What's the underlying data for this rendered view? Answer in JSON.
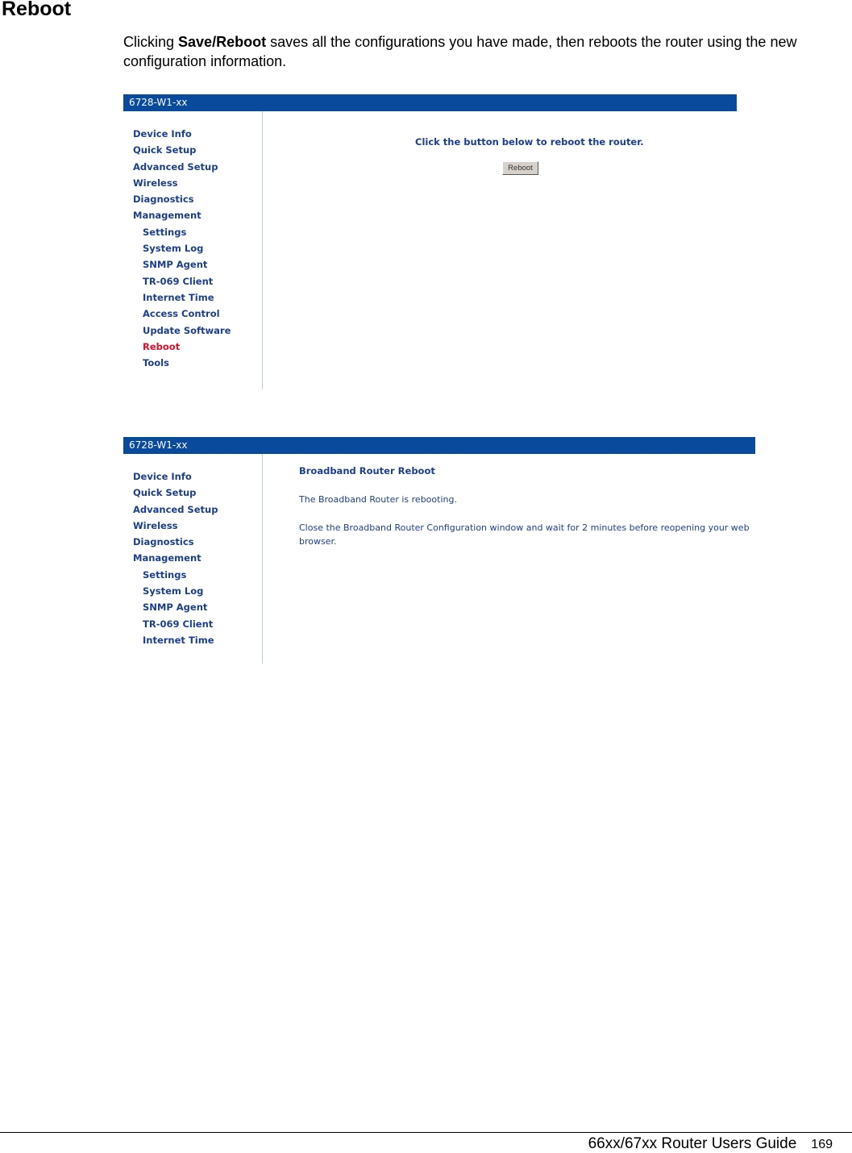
{
  "section": {
    "title": "Reboot",
    "intro_prefix": "Clicking ",
    "intro_bold": "Save/Reboot",
    "intro_suffix": " saves all the configurations you have made, then reboots the router using the new configuration information."
  },
  "screenshot1": {
    "header_title": "6728-W1-xx",
    "nav": [
      {
        "label": "Device Info",
        "level": 0,
        "active": false
      },
      {
        "label": "Quick Setup",
        "level": 0,
        "active": false
      },
      {
        "label": "Advanced Setup",
        "level": 0,
        "active": false
      },
      {
        "label": "Wireless",
        "level": 0,
        "active": false
      },
      {
        "label": "Diagnostics",
        "level": 0,
        "active": false
      },
      {
        "label": "Management",
        "level": 0,
        "active": false
      },
      {
        "label": "Settings",
        "level": 1,
        "active": false
      },
      {
        "label": "System Log",
        "level": 1,
        "active": false
      },
      {
        "label": "SNMP Agent",
        "level": 1,
        "active": false
      },
      {
        "label": "TR-069 Client",
        "level": 1,
        "active": false
      },
      {
        "label": "Internet Time",
        "level": 1,
        "active": false
      },
      {
        "label": "Access Control",
        "level": 1,
        "active": false
      },
      {
        "label": "Update Software",
        "level": 1,
        "active": false
      },
      {
        "label": "Reboot",
        "level": 1,
        "active": true
      },
      {
        "label": "Tools",
        "level": 1,
        "active": false
      }
    ],
    "prompt": "Click the button below to reboot the router.",
    "button_label": "Reboot"
  },
  "screenshot2": {
    "header_title": "6728-W1-xx",
    "nav": [
      {
        "label": "Device Info",
        "level": 0
      },
      {
        "label": "Quick Setup",
        "level": 0
      },
      {
        "label": "Advanced Setup",
        "level": 0
      },
      {
        "label": "Wireless",
        "level": 0
      },
      {
        "label": "Diagnostics",
        "level": 0
      },
      {
        "label": "Management",
        "level": 0
      },
      {
        "label": "Settings",
        "level": 1
      },
      {
        "label": "System Log",
        "level": 1
      },
      {
        "label": "SNMP Agent",
        "level": 1
      },
      {
        "label": "TR-069 Client",
        "level": 1
      },
      {
        "label": "Internet Time",
        "level": 1
      }
    ],
    "message_title": "Broadband Router Reboot",
    "message_line1": "The Broadband Router is rebooting.",
    "message_line2": "Close the Broadband Router Configuration window and wait for 2 minutes before reopening your web browser."
  },
  "footer": {
    "guide_title": "66xx/67xx Router Users Guide",
    "page_number": "169"
  },
  "colors": {
    "header_bar": "#0a4a9c",
    "nav_text": "#1d3f8b",
    "nav_active": "#e0102a"
  }
}
